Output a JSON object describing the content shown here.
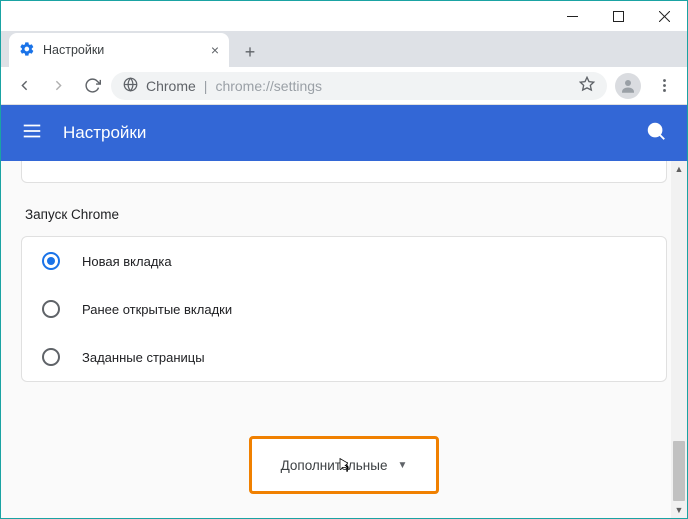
{
  "window": {
    "tab_title": "Настройки"
  },
  "omnibox": {
    "host": "Chrome",
    "path": "chrome://settings"
  },
  "header": {
    "title": "Настройки"
  },
  "section": {
    "startup_title": "Запуск Chrome",
    "options": [
      {
        "label": "Новая вкладка",
        "selected": true
      },
      {
        "label": "Ранее открытые вкладки",
        "selected": false
      },
      {
        "label": "Заданные страницы",
        "selected": false
      }
    ]
  },
  "advanced": {
    "label": "Дополнительные"
  }
}
